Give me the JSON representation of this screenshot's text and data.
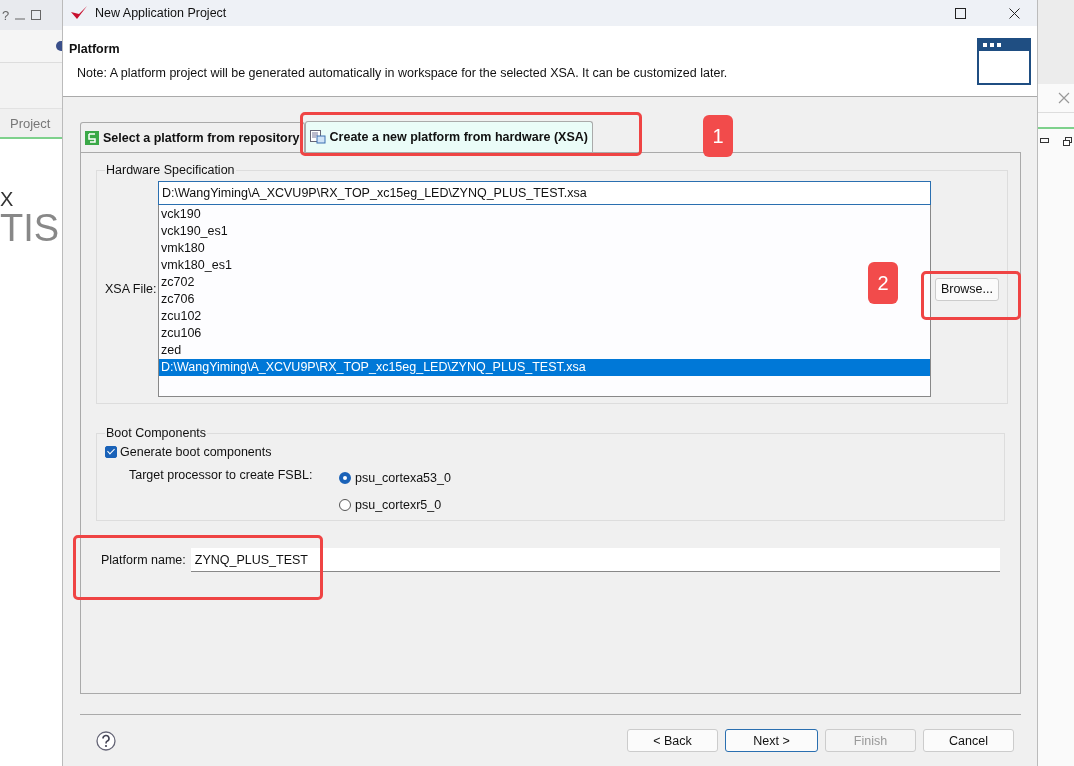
{
  "background": {
    "help": "?",
    "tab_label": "Project",
    "logo_lines": [
      "X",
      "TIS"
    ]
  },
  "dialog": {
    "title": "New Application Project",
    "header": {
      "title": "Platform",
      "note": "Note: A platform project will be generated automatically in workspace for the selected XSA. It can be customized later."
    },
    "tabs": [
      {
        "label": "Select a platform from repository",
        "selected": false,
        "kind": "repository"
      },
      {
        "label": "Create a new platform from hardware (XSA)",
        "selected": true,
        "kind": "hardware"
      }
    ],
    "hardware": {
      "legend": "Hardware Specification",
      "label": "XSA File:",
      "value": "D:\\WangYiming\\A_XCVU9P\\RX_TOP_xc15eg_LED\\ZYNQ_PLUS_TEST.xsa",
      "options": [
        {
          "label": "vck190",
          "selected": false
        },
        {
          "label": "vck190_es1",
          "selected": false
        },
        {
          "label": "vmk180",
          "selected": false
        },
        {
          "label": "vmk180_es1",
          "selected": false
        },
        {
          "label": "zc702",
          "selected": false
        },
        {
          "label": "zc706",
          "selected": false
        },
        {
          "label": "zcu102",
          "selected": false
        },
        {
          "label": "zcu106",
          "selected": false
        },
        {
          "label": "zed",
          "selected": false
        },
        {
          "label": "D:\\WangYiming\\A_XCVU9P\\RX_TOP_xc15eg_LED\\ZYNQ_PLUS_TEST.xsa",
          "selected": true
        }
      ],
      "browse": "Browse..."
    },
    "boot": {
      "legend": "Boot Components",
      "checkbox": {
        "label": "Generate boot components",
        "checked": true
      },
      "target_label": "Target processor to create FSBL:",
      "processors": [
        {
          "label": "psu_cortexa53_0",
          "selected": true
        },
        {
          "label": "psu_cortexr5_0",
          "selected": false
        }
      ]
    },
    "platform_name": {
      "label": "Platform name:",
      "value": "ZYNQ_PLUS_TEST"
    },
    "buttons": [
      {
        "label": "< Back",
        "disabled": false,
        "default": false
      },
      {
        "label": "Next >",
        "disabled": false,
        "default": true
      },
      {
        "label": "Finish",
        "disabled": true,
        "default": false
      },
      {
        "label": "Cancel",
        "disabled": false,
        "default": false
      }
    ]
  },
  "annotations": [
    {
      "label": "1"
    },
    {
      "label": "2"
    }
  ]
}
